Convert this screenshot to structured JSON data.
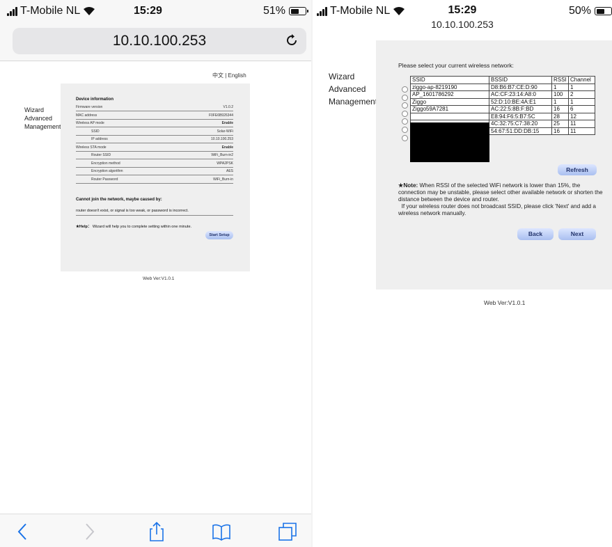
{
  "left": {
    "status": {
      "carrier": "T-Mobile NL",
      "time": "15:29",
      "battery": "51%"
    },
    "url": "10.10.100.253",
    "lang": "中文 | English",
    "nav": [
      "Wizard",
      "Advanced",
      "Management"
    ],
    "device_info": {
      "title": "Device information",
      "rows": [
        {
          "k": "Firmware version",
          "v": "V1.0.2"
        },
        {
          "k": "MAC address",
          "v": "F0FE6B926344"
        },
        {
          "k": "Wireless AP mode",
          "v": "Enable"
        },
        {
          "k": "SSID",
          "v": "Solar-WiFi"
        },
        {
          "k": "IP address",
          "v": "10.10.100.253"
        },
        {
          "k": "Wireless STA mode",
          "v": "Enable"
        },
        {
          "k": "Router SSID",
          "v": "WiFi_Burn-in2"
        },
        {
          "k": "Encryption method",
          "v": "WPA2PSK"
        },
        {
          "k": "Encryption algorithm",
          "v": "AES"
        },
        {
          "k": "Router Password",
          "v": "WiFi_Burn-in"
        }
      ]
    },
    "error_title": "Cannot join the network,  maybe caused by:",
    "error_text": "router doesn't exist,  or signal is too weak,  or password is incorrect.",
    "help_label": "★Help：",
    "help_text": "Wizard will help you to complete setting within one minute.",
    "start_setup": "Start Setup",
    "web_ver": "Web Ver:V1.0.1"
  },
  "right": {
    "status": {
      "carrier": "T-Mobile NL",
      "time": "15:29",
      "battery": "50%"
    },
    "url": "10.10.100.253",
    "nav": [
      "Wizard",
      "Advanced",
      "Management"
    ],
    "prompt": "Please select your current wireless network:",
    "table": {
      "headers": [
        "SSID",
        "BSSID",
        "RSSI",
        "Channel"
      ],
      "rows": [
        [
          "ziggo-ap-8219190",
          "D8:B6:B7:CE:D:90",
          "1",
          "1"
        ],
        [
          "AP_1601786292",
          "AC:CF:23:14:A8:0",
          "100",
          "2"
        ],
        [
          "Ziggo",
          "52:D:10:BE:4A:E1",
          "1",
          "1"
        ],
        [
          "Ziggo59A7281",
          "AC:22:5:8B:F:BD",
          "16",
          "6"
        ],
        [
          "",
          "E8:94:F6:5:B7:5C",
          "28",
          "12"
        ],
        [
          "",
          "4C:32:75:C7:38:20",
          "25",
          "11"
        ],
        [
          "",
          "54:67:51:DD:DB:15",
          "16",
          "11"
        ]
      ]
    },
    "refresh": "Refresh",
    "note_label": "★Note:",
    "note_text": "When RSSI of the selected WiFi network is lower than 15%,  the connection may be unstable,  please select other available network or shorten the distance between the device and router.",
    "note_text2": "If your wireless router does not broadcast SSID,  please click  'Next'  and add a wireless network manually.",
    "back": "Back",
    "next": "Next",
    "web_ver": "Web Ver:V1.0.1"
  }
}
